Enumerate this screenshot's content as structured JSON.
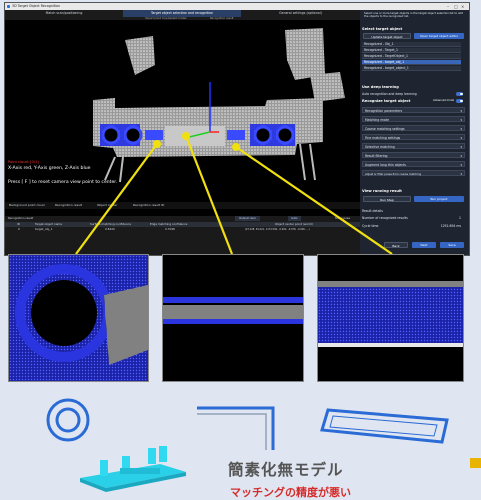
{
  "window": {
    "title": "3D Target Object Recognition",
    "steps": [
      "Match scan/positioning",
      "Target object selection and recognition",
      "General settings (optional)"
    ],
    "substeps": [
      "Import point cloud/select model",
      "Recognition result"
    ]
  },
  "viewport": {
    "status_line": "Point cloud: [0/1]",
    "axis_legend": "X-Axis red, Y-Axis green, Z-Axis blue",
    "hint": "Press [ F ] to reset camera view point to center.",
    "toolbar": [
      "Background point cloud",
      "Recognition result",
      "Object center",
      "Recognition result ID"
    ]
  },
  "table": {
    "title": "Recognition result",
    "sort_label": "Sort",
    "show_label": "Show pose",
    "dropdown_value": "Output rank",
    "auto_label": "Auto",
    "headers": [
      "ID",
      "Target object name",
      "Surface matching confidence",
      "Edge matching confidence",
      "Object center point (world)"
    ],
    "rows": [
      [
        "0",
        "target_obj_1",
        "0.8420",
        "0.7098",
        "(97.228, 81.021, 1174.590, -0.092, -0.078, -0.006, ...)"
      ]
    ]
  },
  "panel": {
    "notice": "Select one or more target objects in the target object selection list to add the objects to the recognized list.",
    "select_target_header": "Select target object",
    "update_button": "Update target object",
    "open_button": "Open target object editor",
    "recognized_items": [
      "Recognized - Obj_1",
      "Recognized - Target_1",
      "Recognized - TargetObject_1",
      "Recognized - target_obj_1",
      "Recognized - target_object_1"
    ],
    "selected_index": 3,
    "deep_learning_header": "Use deep learning",
    "deep_learning_option": "Auto recognition and deep learning",
    "recognize_header": "Recognize target object",
    "advanced_mode": "Advanced mode",
    "dropdowns": [
      "Recognition parameters",
      "Matching mode",
      "Coarse matching settings",
      "Fine matching settings",
      "Selective matching",
      "Result filtering",
      "Augment long thin objects",
      "Adjust or filter poses from coarse matching"
    ],
    "view_header": "View running result",
    "run_step": "Run Step",
    "run_project": "Run project",
    "result_details": "Result details",
    "num_label": "Number of recognized results",
    "num_value": "1",
    "cycle_label": "Cycle time",
    "cycle_value": "1292.894 ms",
    "back": "Back",
    "next": "Next",
    "save": "Save"
  },
  "caption": {
    "title": "簡素化無モデル",
    "subtitle": "マッチングの精度が悪い"
  },
  "colors": {
    "callout": "#f0e010",
    "accent": "#3566c4",
    "subtitle": "#d62b2b",
    "cyan_shape": "#2ad0e8",
    "blue_shape": "#2b6bd6"
  }
}
